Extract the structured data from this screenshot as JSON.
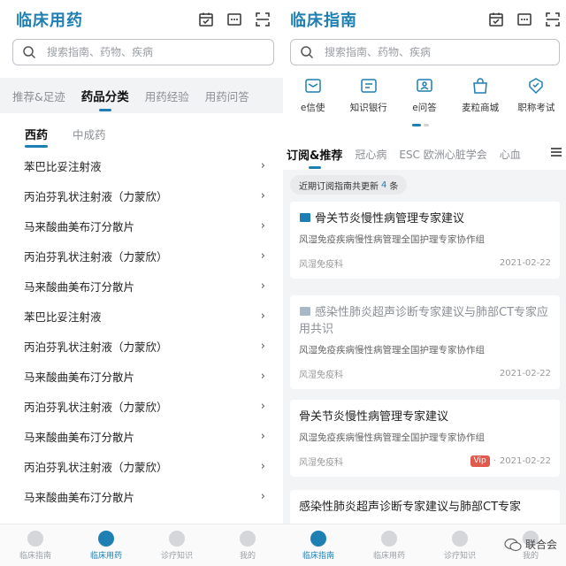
{
  "left": {
    "brand": "临床用药",
    "search_placeholder": "搜索指南、药物、疾病",
    "tabs": [
      {
        "label": "推荐&足迹"
      },
      {
        "label": "药品分类"
      },
      {
        "label": "用药经验"
      },
      {
        "label": "用药问答"
      }
    ],
    "active_tab": 1,
    "subtabs": [
      {
        "label": "西药"
      },
      {
        "label": "中成药"
      }
    ],
    "drugs": [
      {
        "name": "苯巴比妥注射液"
      },
      {
        "name": "丙泊芬乳状注射液（力蒙欣）"
      },
      {
        "name": "马来酸曲美布汀分散片"
      },
      {
        "name": "丙泊芬乳状注射液（力蒙欣）"
      },
      {
        "name": "马来酸曲美布汀分散片"
      },
      {
        "name": "苯巴比妥注射液"
      },
      {
        "name": "丙泊芬乳状注射液（力蒙欣）"
      },
      {
        "name": "马来酸曲美布汀分散片"
      },
      {
        "name": "丙泊芬乳状注射液（力蒙欣）"
      },
      {
        "name": "马来酸曲美布汀分散片"
      },
      {
        "name": "丙泊芬乳状注射液（力蒙欣）"
      },
      {
        "name": "马来酸曲美布汀分散片"
      }
    ],
    "chevron": "›",
    "bottom_nav": [
      {
        "label": "临床指南"
      },
      {
        "label": "临床用药"
      },
      {
        "label": "诊疗知识"
      },
      {
        "label": "我的"
      }
    ],
    "active_nav": 1
  },
  "right": {
    "brand": "临床指南",
    "search_placeholder": "搜索指南、药物、疾病",
    "quick_icons": [
      {
        "label": "e信使",
        "icon": "mail-icon"
      },
      {
        "label": "知识银行",
        "icon": "note-icon"
      },
      {
        "label": "e问答",
        "icon": "qa-icon"
      },
      {
        "label": "麦粒商城",
        "icon": "bag-icon"
      },
      {
        "label": "职称考试",
        "icon": "badge-icon"
      }
    ],
    "tabs": [
      {
        "label": "订阅&推荐"
      },
      {
        "label": "冠心病"
      },
      {
        "label": "ESC 欧洲心脏学会"
      },
      {
        "label": "心血"
      }
    ],
    "update": {
      "prefix": "近期订阅指南共更新",
      "count": "4",
      "suffix": "条"
    },
    "cards": [
      {
        "title": "骨关节炎慢性病管理专家建议",
        "subtitle": "风湿免疫疾病慢性病管理全国护理专家协作组",
        "dept": "风湿免疫科",
        "date": "2021-02-22",
        "vip": "",
        "muted": false,
        "doc_icon": true
      },
      {
        "title": "感染性肺炎超声诊断专家建议与肺部CT专家应用共识",
        "subtitle": "风湿免疫疾病慢性病管理全国护理专家协作组",
        "dept": "风湿免疫科",
        "date": "2021-02-22",
        "vip": "",
        "muted": true,
        "doc_icon": true
      },
      {
        "title": "骨关节炎慢性病管理专家建议",
        "subtitle": "风湿免疫疾病慢性病管理全国护理专家协作组",
        "dept": "风湿免疫科",
        "date": "2021-02-22",
        "vip": "Vip",
        "muted": false,
        "doc_icon": false
      },
      {
        "title": "感染性肺炎超声诊断专家建议与肺部CT专家",
        "subtitle": "",
        "dept": "",
        "date": "",
        "vip": "",
        "muted": false,
        "doc_icon": false
      }
    ],
    "bottom_nav": [
      {
        "label": "临床指南"
      },
      {
        "label": "临床用药"
      },
      {
        "label": "诊疗知识"
      },
      {
        "label": "我的"
      }
    ],
    "active_nav": 0,
    "date_sep": "·"
  },
  "watermark": "联合会",
  "colors": {
    "accent": "#1e7fb3",
    "vip": "#e05a4e"
  }
}
